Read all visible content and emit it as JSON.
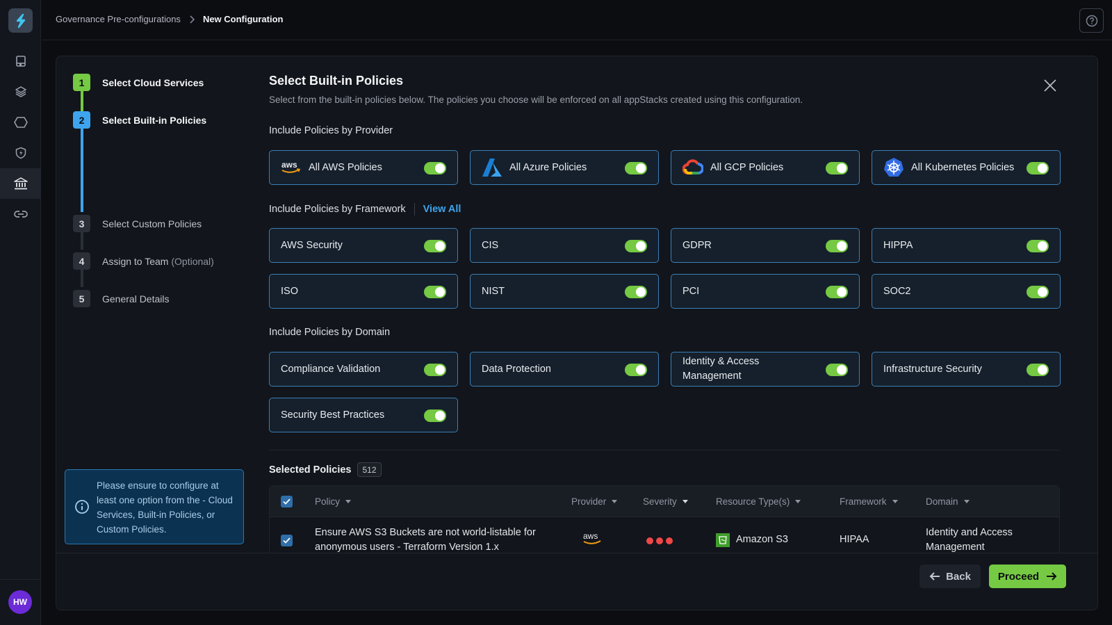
{
  "app": {
    "user_initials": "HW"
  },
  "breadcrumb": {
    "parent": "Governance Pre-configurations",
    "separator": ">",
    "current": "New Configuration"
  },
  "sidebar": {
    "items": [
      {
        "name": "book-icon",
        "active": false
      },
      {
        "name": "layers-icon",
        "active": false
      },
      {
        "name": "hexagon-icon",
        "active": false
      },
      {
        "name": "shield-bolt-icon",
        "active": false
      },
      {
        "name": "institution-icon",
        "active": true
      },
      {
        "name": "link-icon",
        "active": false
      }
    ]
  },
  "stepper": {
    "steps": [
      {
        "number": "1",
        "label": "Select Cloud Services",
        "state": "done"
      },
      {
        "number": "2",
        "label": "Select Built-in Policies",
        "state": "current"
      },
      {
        "number": "3",
        "label": "Select Custom Policies",
        "state": "todo"
      },
      {
        "number": "4",
        "label": "Assign to Team",
        "optional": "(Optional)",
        "state": "todo"
      },
      {
        "number": "5",
        "label": "General Details",
        "state": "todo"
      }
    ],
    "info": "Please ensure to configure at least one option from the - Cloud Services, Built-in Policies, or Custom Policies."
  },
  "main": {
    "title": "Select Built-in Policies",
    "subtitle": "Select from the built-in policies below. The policies you choose will be enforced on all appStacks created using this configuration.",
    "provider_section": {
      "heading": "Include Policies by Provider",
      "items": [
        {
          "label": "All AWS Policies",
          "icon": "aws-logo-icon",
          "enabled": true
        },
        {
          "label": "All Azure Policies",
          "icon": "azure-logo-icon",
          "enabled": true
        },
        {
          "label": "All GCP Policies",
          "icon": "gcp-logo-icon",
          "enabled": true
        },
        {
          "label": "All Kubernetes Policies",
          "icon": "kubernetes-logo-icon",
          "enabled": true
        }
      ]
    },
    "framework_section": {
      "heading": "Include Policies by Framework",
      "view_all": "View All",
      "items": [
        {
          "label": "AWS Security",
          "enabled": true
        },
        {
          "label": "CIS",
          "enabled": true
        },
        {
          "label": "GDPR",
          "enabled": true
        },
        {
          "label": "HIPPA",
          "enabled": true
        },
        {
          "label": "ISO",
          "enabled": true
        },
        {
          "label": "NIST",
          "enabled": true
        },
        {
          "label": "PCI",
          "enabled": true
        },
        {
          "label": "SOC2",
          "enabled": true
        }
      ]
    },
    "domain_section": {
      "heading": "Include Policies by Domain",
      "items": [
        {
          "label": "Compliance Validation",
          "enabled": true
        },
        {
          "label": "Data Protection",
          "enabled": true
        },
        {
          "label": "Identity & Access Management",
          "enabled": true
        },
        {
          "label": "Infrastructure Security",
          "enabled": true
        },
        {
          "label": "Security Best Practices",
          "enabled": true
        }
      ]
    },
    "selected": {
      "heading": "Selected Policies",
      "count": "512",
      "columns": [
        "Policy",
        "Provider",
        "Severity",
        "Resource Type(s)",
        "Framework",
        "Domain"
      ],
      "rows": [
        {
          "checked": true,
          "policy": "Ensure AWS S3 Buckets are not world-listable for anonymous users - Terraform Version 1.x",
          "provider": "aws",
          "severity": "high",
          "resource_type": "Amazon S3",
          "framework": "HIPAA",
          "domain": "Identity and Access Management"
        }
      ]
    }
  },
  "footer": {
    "back": "Back",
    "proceed": "Proceed"
  },
  "colors": {
    "accent_green": "#75c943",
    "accent_blue": "#3ea4ee",
    "tile_border": "#3c7fb6",
    "severity_high": "#ef4747"
  }
}
